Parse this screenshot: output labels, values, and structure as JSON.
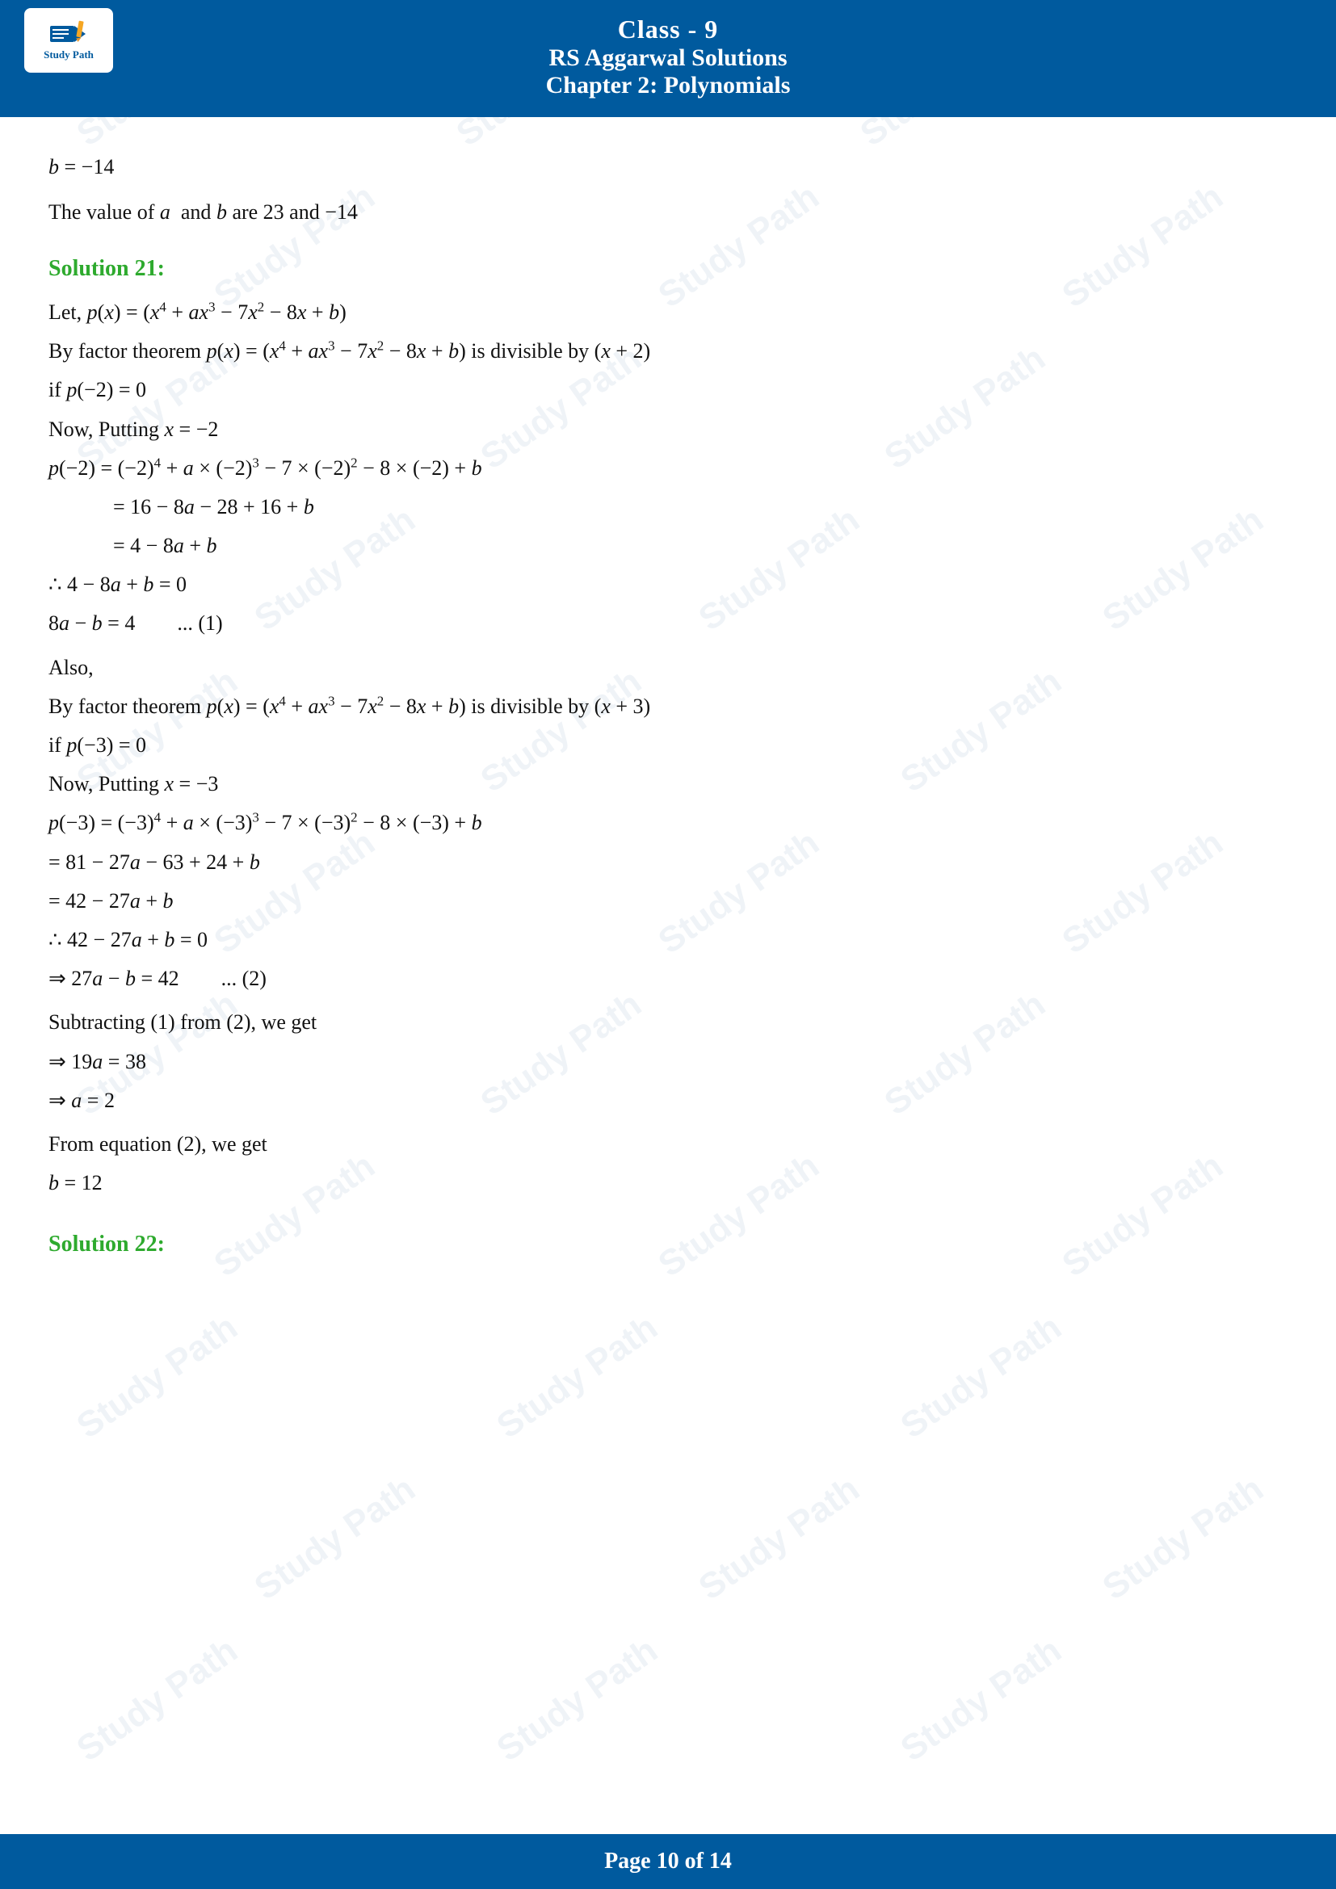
{
  "header": {
    "class_label": "Class - 9",
    "book_label": "RS Aggarwal Solutions",
    "chapter_label": "Chapter 2: Polynomials",
    "logo_text": "Study Path"
  },
  "footer": {
    "page_label": "Page 10 of 14"
  },
  "content": {
    "opening_line": "b = −14",
    "value_statement": "The value of a  and b are 23 and −14",
    "solution21_heading": "Solution 21:",
    "sol21_lines": [
      "Let, p(x) = (x⁴ + ax³ − 7x² − 8x + b)",
      "By factor theorem p(x) = (x⁴ + ax³ − 7x² − 8x + b) is divisible by (x + 2)",
      "if p(−2) = 0",
      "Now, Putting x = −2",
      "p(−2) = (−2)⁴ + a × (−2)³ − 7 × (−2)² − 8 × (−2) + b",
      "= 16 − 8a − 28 + 16 + b",
      "= 4 − 8a + b",
      "∴ 4 − 8a + b = 0",
      "8a − b = 4        ... (1)",
      "Also,",
      "By factor theorem p(x) = (x⁴ + ax³ − 7x² − 8x + b) is divisible by (x + 3)",
      "if p(−3) = 0",
      "Now, Putting x = −3",
      "p(−3) = (−3)⁴ + a × (−3)³ − 7 × (−3)² − 8 × (−3) + b",
      "= 81 − 27a − 63 + 24 + b",
      "= 42 − 27a + b",
      "∴ 42 − 27a + b = 0",
      "⇒ 27a − b = 42        ... (2)",
      "Subtracting (1) from (2), we get",
      "⇒ 19a = 38",
      "⇒ a = 2",
      "From equation (2), we get",
      "b = 12"
    ],
    "solution22_heading": "Solution 22:"
  },
  "watermark_text": "Study Path"
}
